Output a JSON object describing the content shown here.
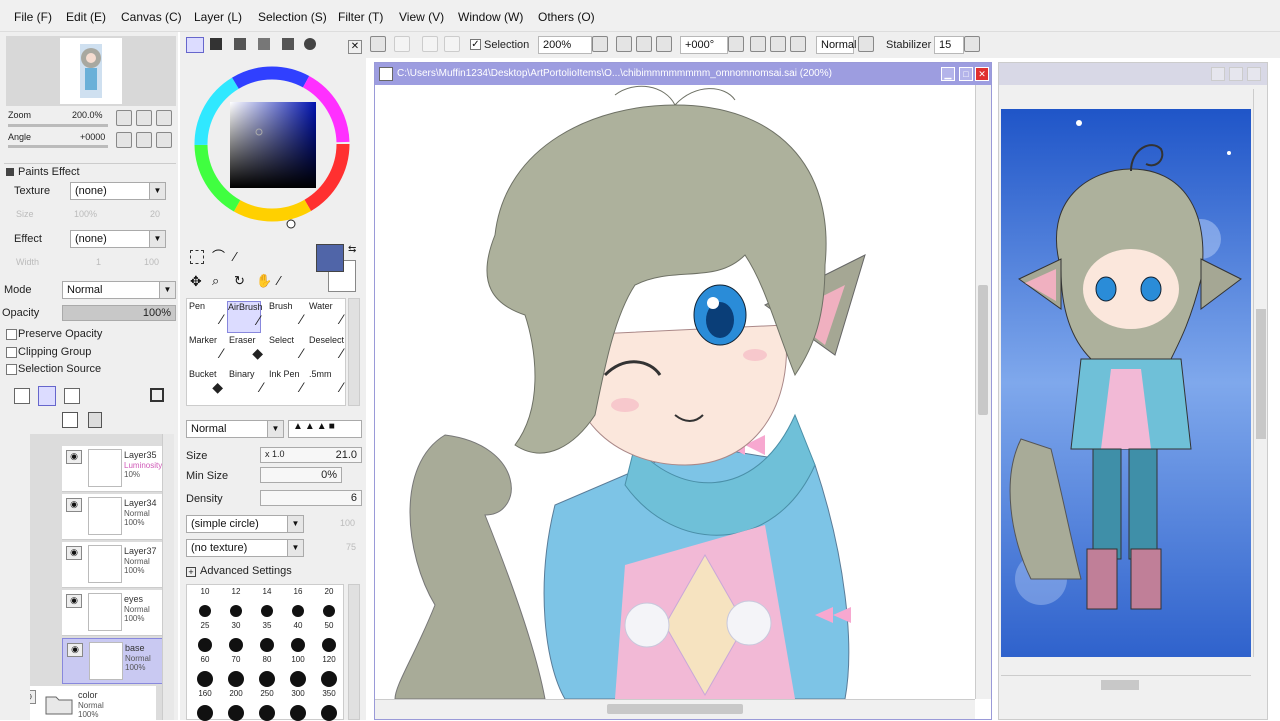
{
  "menu": [
    "File (F)",
    "Edit (E)",
    "Canvas (C)",
    "Layer (L)",
    "Selection (S)",
    "Filter (T)",
    "View (V)",
    "Window (W)",
    "Others (O)"
  ],
  "navigator": {
    "zoom_label": "Zoom",
    "zoom_value": "200.0%",
    "angle_label": "Angle",
    "angle_value": "+0000"
  },
  "paints_effect": {
    "title": "Paints Effect",
    "texture_label": "Texture",
    "texture_value": "(none)",
    "size_label": "Size",
    "size_value": "100%",
    "strength_value": "20",
    "effect_label": "Effect",
    "effect_value": "(none)",
    "width_label": "Width",
    "width_value": "1",
    "width2_value": "100"
  },
  "layer_props": {
    "mode_label": "Mode",
    "mode_value": "Normal",
    "opacity_label": "Opacity",
    "opacity_value": "100%",
    "preserve_opacity": "Preserve Opacity",
    "clipping_group": "Clipping Group",
    "selection_source": "Selection Source"
  },
  "layers": [
    {
      "name": "Layer35",
      "mode": "Luminosity",
      "opacity": "10%"
    },
    {
      "name": "Layer34",
      "mode": "Normal",
      "opacity": "100%"
    },
    {
      "name": "Layer37",
      "mode": "Normal",
      "opacity": "100%"
    },
    {
      "name": "eyes",
      "mode": "Normal",
      "opacity": "100%"
    },
    {
      "name": "base",
      "mode": "Normal",
      "opacity": "100%"
    },
    {
      "name": "color",
      "mode": "Normal",
      "opacity": "100%"
    }
  ],
  "tools": [
    [
      "Pen",
      "AirBrush",
      "Brush",
      "Water"
    ],
    [
      "Marker",
      "Eraser",
      "Select",
      "Deselect"
    ],
    [
      "Bucket",
      "Binary",
      "Ink Pen",
      ".5mm"
    ]
  ],
  "brush_settings": {
    "blend_mode": "Normal",
    "size_label": "Size",
    "size_mult": "x 1.0",
    "size_value": "21.0",
    "min_size_label": "Min Size",
    "min_size_value": "0%",
    "density_label": "Density",
    "density_value": "6",
    "shape": "(simple circle)",
    "shape_value": "100",
    "texture": "(no texture)",
    "texture_value": "75",
    "advanced": "Advanced Settings"
  },
  "brush_sizes": [
    [
      "10",
      "12",
      "14",
      "16",
      "20"
    ],
    [
      "25",
      "30",
      "35",
      "40",
      "50"
    ],
    [
      "60",
      "70",
      "80",
      "100",
      "120"
    ],
    [
      "160",
      "200",
      "250",
      "300",
      "350"
    ]
  ],
  "toolbar": {
    "selection_label": "Selection",
    "zoom": "200%",
    "rotation": "+000°",
    "mode": "Normal",
    "stabilizer_label": "Stabilizer",
    "stabilizer_value": "15"
  },
  "canvas_window": {
    "title": "C:\\Users\\Muffin1234\\Desktop\\ArtPortolioItems\\O...\\chibimmmmmmmm_omnomnomsai.sai (200%)"
  },
  "colors": {
    "primary": "#5065a8",
    "accent_title": "#9d9de0",
    "selected_layer": "#c9c9f2"
  }
}
